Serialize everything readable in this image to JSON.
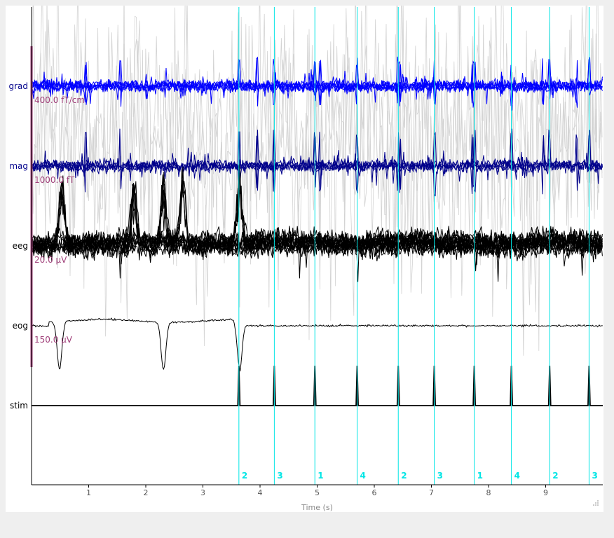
{
  "window": {
    "background": "#efefef",
    "panel_background": "#ffffff"
  },
  "chart_data": {
    "type": "line",
    "title": "",
    "xlabel": "Time (s)",
    "ylabel": "",
    "xlim": [
      0,
      10
    ],
    "x_ticks": [
      1,
      2,
      3,
      4,
      5,
      6,
      7,
      8,
      9
    ],
    "channel_types": [
      {
        "name": "grad",
        "scale": "400.0 fT/cm",
        "color": "#0000ff",
        "label_color": "#00008b"
      },
      {
        "name": "mag",
        "scale": "1000.0 fT",
        "color": "#00008b",
        "label_color": "#00008b"
      },
      {
        "name": "eeg",
        "scale": "20.0 µV",
        "color": "#000000",
        "label_color": "#000000"
      },
      {
        "name": "eog",
        "scale": "150.0 µV",
        "color": "#000000",
        "label_color": "#000000"
      },
      {
        "name": "stim",
        "scale": "",
        "color": "#000000",
        "label_color": "#000000"
      }
    ],
    "scale_label_color": "#a0407a",
    "scale_bar_color": "#a0407a",
    "bad_channel_color": "#d3d3d3",
    "event_color": "#00e5e5",
    "events": [
      {
        "time": 3.63,
        "id": "2"
      },
      {
        "time": 4.25,
        "id": "3"
      },
      {
        "time": 4.96,
        "id": "1"
      },
      {
        "time": 5.7,
        "id": "4"
      },
      {
        "time": 6.42,
        "id": "2"
      },
      {
        "time": 7.05,
        "id": "3"
      },
      {
        "time": 7.75,
        "id": "1"
      },
      {
        "time": 8.4,
        "id": "4"
      },
      {
        "time": 9.07,
        "id": "2"
      },
      {
        "time": 9.76,
        "id": "3"
      }
    ],
    "blinks": [
      0.49,
      2.31,
      3.64
    ],
    "blink_spikes": [
      0.53,
      1.79,
      2.31,
      2.65,
      3.64
    ]
  }
}
